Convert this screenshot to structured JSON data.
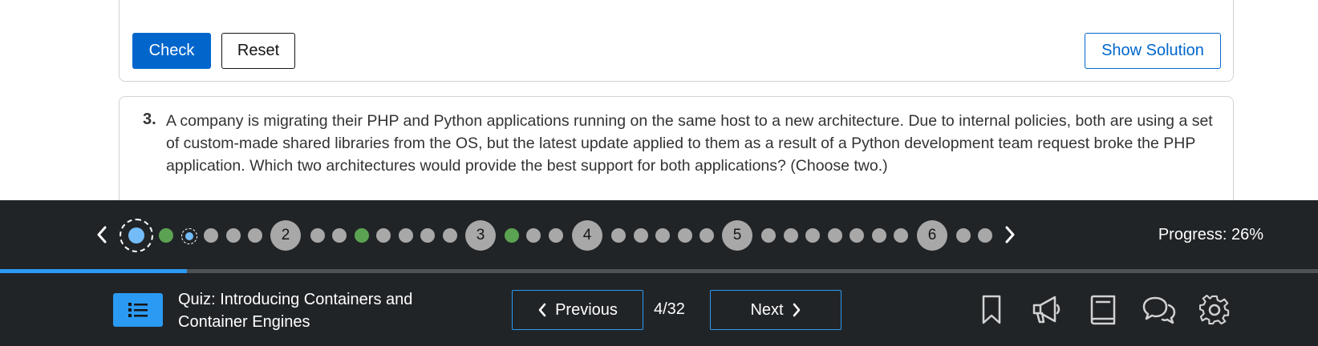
{
  "buttons": {
    "check": "Check",
    "reset": "Reset",
    "show_solution": "Show Solution"
  },
  "question": {
    "number": "3.",
    "text": "A company is migrating their PHP and Python applications running on the same host to a new architecture. Due to internal policies, both are using a set of custom-made shared libraries from the OS, but the latest update applied to them as a result of a Python development team request broke the PHP application. Which two architectures would provide the best support for both applications? (Choose two.)"
  },
  "navigator": {
    "section_labels": [
      "2",
      "3",
      "4",
      "5",
      "6"
    ],
    "progress_label": "Progress: 26%",
    "progress_fraction": 0.26
  },
  "footer": {
    "quiz_title": "Quiz: Introducing Containers and Container Engines",
    "previous_label": "Previous",
    "next_label": "Next",
    "counter": "4/32"
  },
  "icons": [
    "chevron-left-icon",
    "chevron-right-icon",
    "list-icon",
    "bookmark-icon",
    "megaphone-icon",
    "book-icon",
    "chat-icon",
    "gear-icon"
  ],
  "colors": {
    "primary": "#0066cc",
    "accent": "#2b9af3",
    "bar_bg": "#212427",
    "answered": "#5ba352",
    "unanswered": "#a8a8a8"
  }
}
